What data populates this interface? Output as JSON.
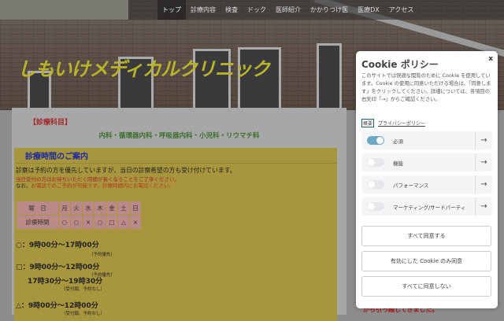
{
  "nav": {
    "items": [
      "トップ",
      "診療内容",
      "検査",
      "ドック",
      "医師紹介",
      "かかりつけ医",
      "医療DX",
      "アクセス"
    ],
    "active": 0
  },
  "hero": {
    "title": "しもいけメディカルクリニック"
  },
  "main": {
    "category_heading": "【診療科目】",
    "categories": "内科・循環器内科・呼吸器内科・小児科・リウマチ科",
    "hours_heading": "診療時間のご案内",
    "intro": "診察は予約の方を優先していますが、当日の診察希望の方も受け付けています。",
    "note1": "当日受付の方はお待ちいただく時間が長くなることをご了承ください。",
    "note2_prefix": "なお、",
    "note2_red": "お電話でのご予約が可能です。診療時間内にお電話ください。",
    "table": {
      "header": [
        "曜　日",
        "月",
        "火",
        "水",
        "木",
        "金",
        "土",
        "日"
      ],
      "row": [
        "診療時間",
        "○",
        "○",
        "×",
        "○",
        "□",
        "△",
        "×"
      ]
    },
    "schedule": [
      {
        "mark": "○：",
        "time": "9時00分〜17時00分",
        "note": "（予約優先）"
      },
      {
        "mark": "□：",
        "time": "9時00分〜12時00分",
        "note": "（予約優先）",
        "time2": "17時30分〜19時30分",
        "note2": "（受付順、予約なし）"
      },
      {
        "mark": "△：",
        "time": "9時00分〜12時00分",
        "note": "（受付順、予約なし）"
      }
    ],
    "moved_text": "から引っ越してきました。"
  },
  "cookie": {
    "title": "Cookie ポリシー",
    "close": "x",
    "description": "このサイトでは快適な閲覧のために Cookie を使用しています。Cookie の使用に同意いただける場合は、「同意します」をクリックしてください。詳細については、各項目の右矢印「→」からご確認ください。",
    "link_settings": "概要",
    "link_privacy": "プライバシーポリシー",
    "categories": [
      {
        "label": "必須",
        "enabled": true
      },
      {
        "label": "機能",
        "enabled": false
      },
      {
        "label": "パフォーマンス",
        "enabled": false
      },
      {
        "label": "マーケティング/サードパーティ",
        "enabled": false
      }
    ],
    "arrow": "→",
    "buttons": {
      "accept_all": "すべて同意する",
      "accept_selected": "有効にした Cookie のみ同意",
      "reject_all": "すべてに同意しない"
    }
  }
}
